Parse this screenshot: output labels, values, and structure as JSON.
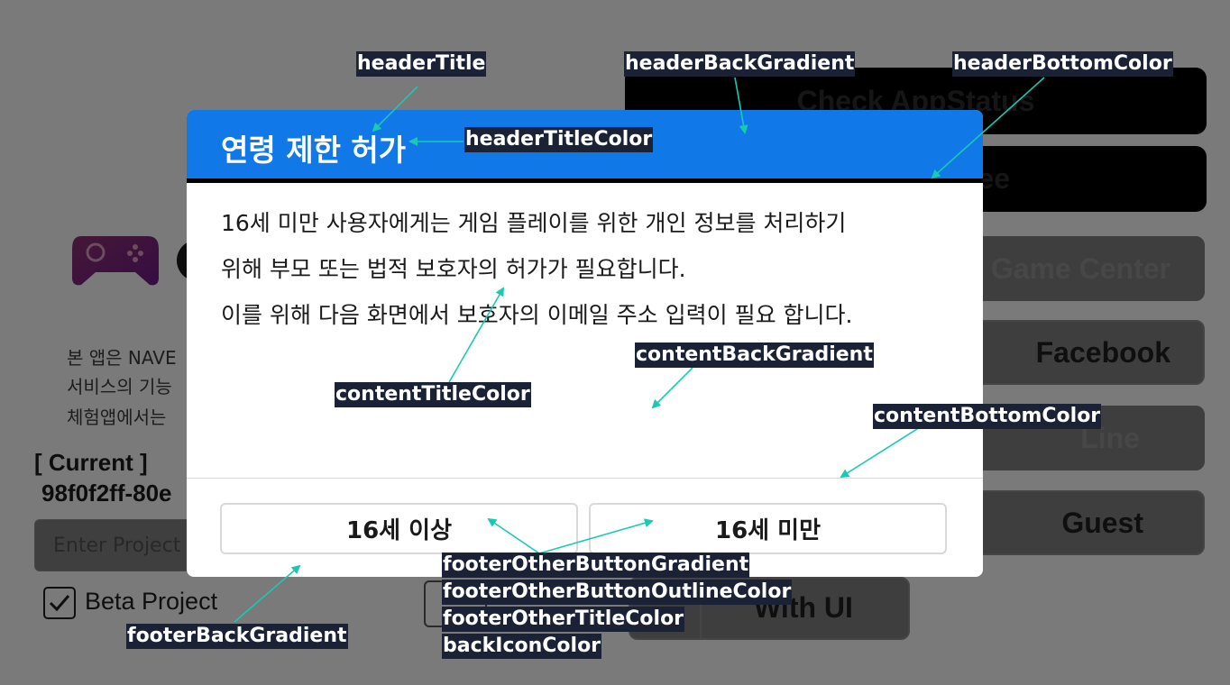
{
  "background": {
    "top_button_1": "Check AppStatus",
    "top_button_2_partial": "ee",
    "login_buttons": [
      "Game Center",
      "Facebook",
      "Line",
      "Guest"
    ],
    "intro_lines": [
      "본 앱은 NAVE",
      "서비스의 기능",
      "체험앱에서는"
    ],
    "current_label": "[ Current ]",
    "current_value": "98f0f2ff-80e",
    "project_input_placeholder": "Enter Project",
    "beta_project_label": "Beta Project",
    "with_ui_label": "With UI"
  },
  "dialog": {
    "header_title": "연령 제한 허가",
    "content_lines": [
      "16세 미만 사용자에게는 게임 플레이를 위한 개인 정보를 처리하기",
      "위해 부모 또는 법적 보호자의 허가가 필요합니다.",
      "이를 위해 다음 화면에서 보호자의 이메일 주소 입력이 필요 합니다."
    ],
    "button_left": "16세 이상",
    "button_right": "16세 미만"
  },
  "annotations": {
    "headerTitle": "headerTitle",
    "headerBackGradient": "headerBackGradient",
    "headerBottomColor": "headerBottomColor",
    "headerTitleColor": "headerTitleColor",
    "contentBackGradient": "contentBackGradient",
    "contentTitleColor": "contentTitleColor",
    "contentBottomColor": "contentBottomColor",
    "footerOtherButtonGradient": "footerOtherButtonGradient",
    "footerOtherButtonOutlineColor": "footerOtherButtonOutlineColor",
    "footerOtherTitleColor": "footerOtherTitleColor",
    "backIconColor": "backIconColor",
    "footerBackGradient": "footerBackGradient"
  },
  "colors": {
    "header_back": "#1178e8",
    "header_bottom": "#000000",
    "annotation_arrow": "#19c9b4",
    "annotation_label_bg": "#1b2235"
  }
}
